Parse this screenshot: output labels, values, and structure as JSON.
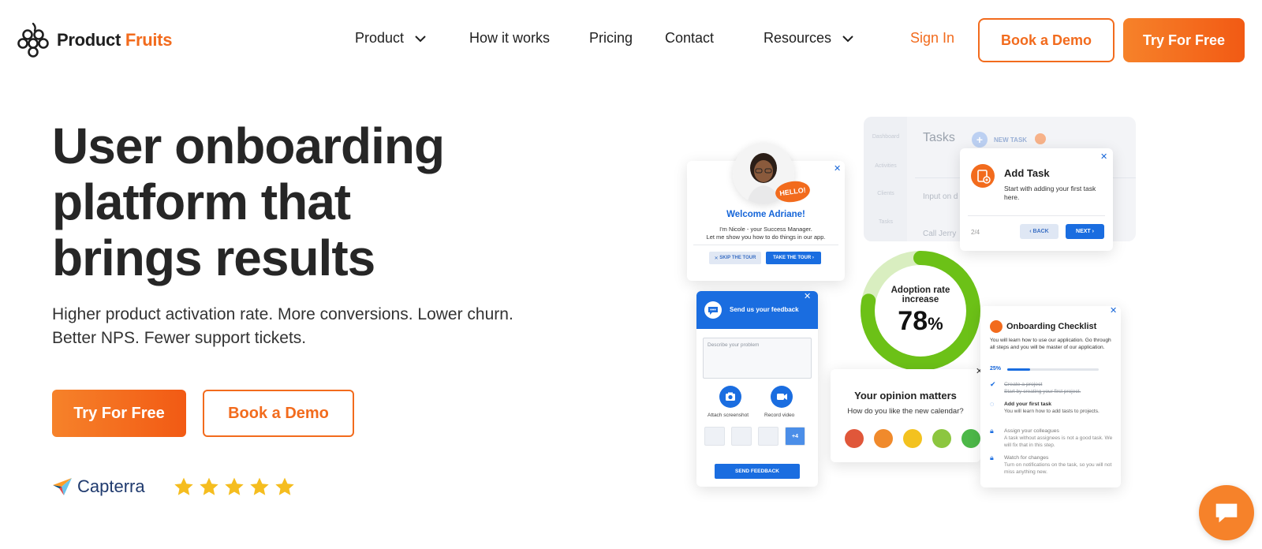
{
  "brand": {
    "name_part1": "Product",
    "name_part2": "Fruits",
    "accent": "#f26b1d"
  },
  "nav": {
    "items": [
      {
        "label": "Product",
        "has_dropdown": true
      },
      {
        "label": "How it works",
        "has_dropdown": false
      },
      {
        "label": "Pricing",
        "has_dropdown": false
      },
      {
        "label": "Contact",
        "has_dropdown": false
      },
      {
        "label": "Resources",
        "has_dropdown": true
      }
    ],
    "sign_in": "Sign In",
    "book_demo": "Book a Demo",
    "try_free": "Try For Free"
  },
  "hero": {
    "title_line1": "User onboarding",
    "title_line2": "platform that",
    "title_line3": "brings results",
    "subtitle": "Higher product activation rate. More conversions. Lower churn. Better NPS. Fewer support tickets.",
    "try_free": "Try For Free",
    "book_demo": "Book a Demo",
    "capterra": "Capterra",
    "rating": 5
  },
  "illustration": {
    "app_mock": {
      "title": "Tasks",
      "new_task": "NEW TASK",
      "sidebar": [
        "Dashboard",
        "Activities",
        "Clients",
        "Tasks"
      ],
      "rows": [
        "Input on d",
        "Call Jerry"
      ]
    },
    "add_task": {
      "title": "Add Task",
      "desc": "Start with adding your first task here.",
      "step": "2/4",
      "back": "BACK",
      "next": "NEXT"
    },
    "welcome": {
      "badge": "HELLO!",
      "title": "Welcome Adriane!",
      "desc_line1": "I'm Nicole - your Success Manager.",
      "desc_line2": "Let me show you how to do things in our app.",
      "skip": "SKIP THE TOUR",
      "take": "TAKE THE TOUR"
    },
    "feedback": {
      "title": "Send us your feedback",
      "placeholder": "Describe your problem",
      "attach": "Attach screenshot",
      "record": "Record video",
      "more_thumbs": "+4",
      "send": "SEND FEEDBACK"
    },
    "adoption": {
      "title_line1": "Adoption rate",
      "title_line2": "increase",
      "value": "78",
      "unit": "%",
      "fraction": 0.78
    },
    "opinion": {
      "title": "Your opinion matters",
      "question": "How do you like the new calendar?",
      "faces": [
        "#e0573a",
        "#f08a2c",
        "#f3c21f",
        "#8cc63f",
        "#4cb848"
      ]
    },
    "checklist": {
      "title": "Onboarding Checklist",
      "desc": "You will learn how to use our application. Go through all steps and you will be master of our application.",
      "progress_label": "25%",
      "progress": 0.25,
      "items": [
        {
          "title": "Create a project",
          "desc": "Start by creating your first project."
        },
        {
          "title": "Add your first task",
          "desc": "You will learn how to add tasts to projects."
        },
        {
          "title": "Assign your colleagues",
          "desc": "A task without assignees is not a good task. We will fix that in this step."
        },
        {
          "title": "Watch for changes",
          "desc": "Turn on notifications on the task, so you will not miss anything new."
        }
      ]
    }
  }
}
